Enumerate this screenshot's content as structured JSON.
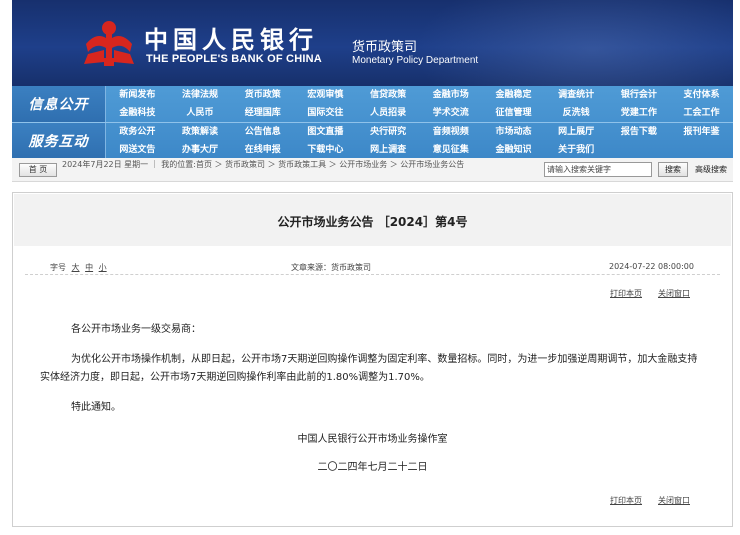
{
  "header": {
    "bank_name_cn": "中国人民银行",
    "bank_name_en": "THE PEOPLE'S BANK OF CHINA",
    "dept_cn": "货币政策司",
    "dept_en": "Monetary Policy Department",
    "logo_icon": "pboc-logo-icon",
    "colors": {
      "banner": "#1e3f8a",
      "nav": "#4f9bd6",
      "logo": "#d7261e"
    }
  },
  "nav": {
    "row1": {
      "label": "信息公开",
      "top": [
        "新闻发布",
        "法律法规",
        "货币政策",
        "宏观审慎",
        "信贷政策",
        "金融市场",
        "金融稳定",
        "调查统计",
        "银行会计",
        "支付体系"
      ],
      "bottom": [
        "金融科技",
        "人民币",
        "经理国库",
        "国际交往",
        "人员招录",
        "学术交流",
        "征信管理",
        "反洗钱",
        "党建工作",
        "工会工作"
      ]
    },
    "row2": {
      "label": "服务互动",
      "top": [
        "政务公开",
        "政策解读",
        "公告信息",
        "图文直播",
        "央行研究",
        "音频视频",
        "市场动态",
        "网上展厅",
        "报告下载",
        "报刊年鉴"
      ],
      "bottom": [
        "网送文告",
        "办事大厅",
        "在线申报",
        "下载中心",
        "网上调查",
        "意见征集",
        "金融知识",
        "关于我们"
      ]
    }
  },
  "breadcrumb": {
    "home": "首 页",
    "text": "2024年7月22日 星期一 ｜ 我的位置:首页 ＞ 货币政策司 ＞ 货币政策工具 ＞ 公开市场业务 ＞ 公开市场业务公告",
    "search_value": "请输入搜索关键字",
    "search_button": "搜索",
    "advanced": "高级搜索"
  },
  "article": {
    "title": "公开市场业务公告 ［2024］第4号",
    "font_size_label": "字号",
    "font_sizes": [
      "大",
      "中",
      "小"
    ],
    "source": "文章来源：货币政策司",
    "date": "2024-07-22 08:00:00",
    "print": "打印本页",
    "close": "关闭窗口",
    "salutation": "各公开市场业务一级交易商：",
    "body": "为优化公开市场操作机制，从即日起，公开市场7天期逆回购操作调整为固定利率、数量招标。同时，为进一步加强逆周期调节，加大金融支持实体经济力度，即日起，公开市场7天期逆回购操作利率由此前的1.80%调整为1.70%。",
    "notice": "特此通知。",
    "signature": "中国人民银行公开市场业务操作室",
    "sign_date": "二〇二四年七月二十二日"
  }
}
